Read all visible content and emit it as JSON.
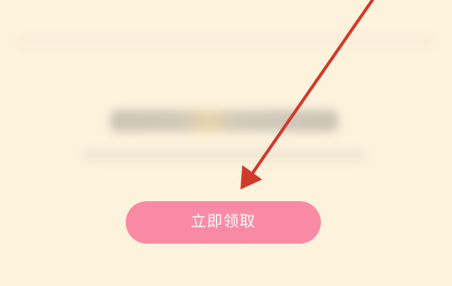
{
  "claim_button": {
    "label": "立即领取",
    "background": "#f98aa6",
    "text_color": "#ffffff"
  },
  "page": {
    "background": "#fdf2dc"
  },
  "annotation": {
    "icon": "red-arrow-icon",
    "color": "#d0392b"
  }
}
